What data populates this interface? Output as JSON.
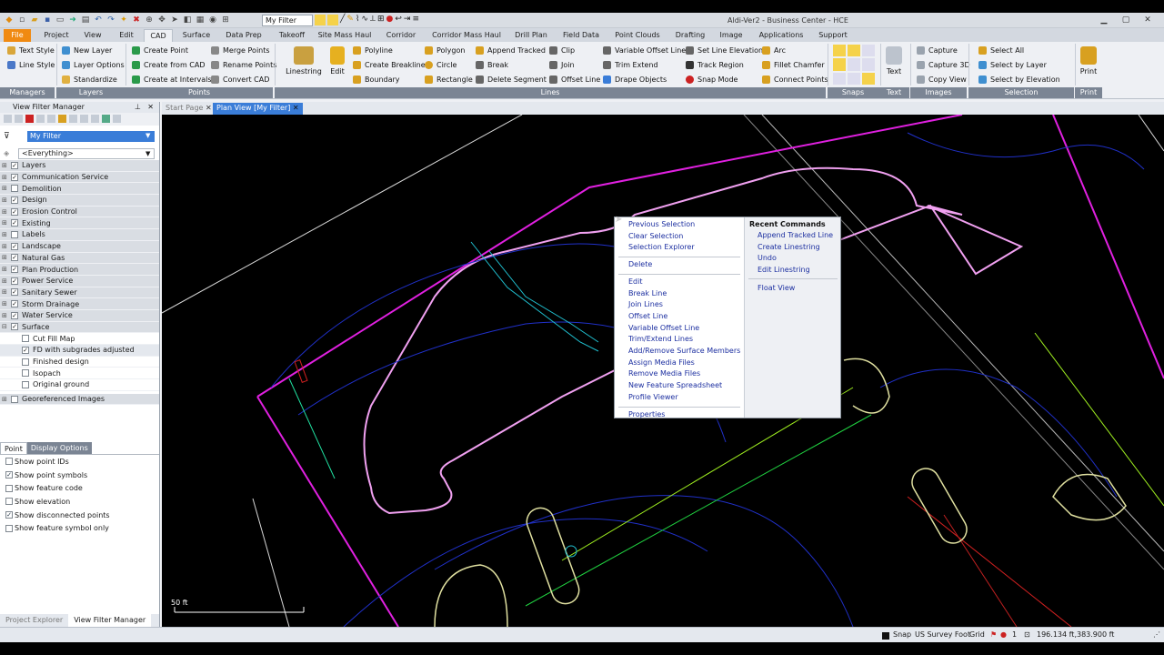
{
  "window": {
    "title": "Aldi-Ver2 - Business Center - HCE",
    "filter_combo": "My Filter"
  },
  "tabs": [
    "File",
    "Project",
    "View",
    "Edit",
    "CAD",
    "Surface",
    "Data Prep",
    "Takeoff",
    "Site Mass Haul",
    "Corridor",
    "Corridor Mass Haul",
    "Drill Plan",
    "Field Data",
    "Point Clouds",
    "Drafting",
    "Image",
    "Applications",
    "Support"
  ],
  "active_tab": "CAD",
  "ribbon": {
    "managers": {
      "text_style": "Text Style",
      "line_style": "Line Style",
      "label": "Managers"
    },
    "layers": {
      "new_layer": "New Layer",
      "layer_options": "Layer Options",
      "standardize": "Standardize",
      "label": "Layers"
    },
    "points": {
      "create_point": "Create Point",
      "create_from_cad": "Create from CAD",
      "create_at_intervals": "Create at Intervals",
      "merge_points": "Merge Points",
      "rename_points": "Rename Points",
      "convert_cad": "Convert CAD",
      "label": "Points"
    },
    "lines": {
      "linestring": "Linestring",
      "edit": "Edit",
      "polyline": "Polyline",
      "create_breakline": "Create Breakline",
      "boundary": "Boundary",
      "polygon": "Polygon",
      "circle": "Circle",
      "rectangle": "Rectangle",
      "append_tracked": "Append Tracked",
      "break": "Break",
      "delete_segment": "Delete Segment",
      "clip": "Clip",
      "join": "Join",
      "offset_line": "Offset Line",
      "variable_offset_line": "Variable Offset Line",
      "trim_extend": "Trim Extend",
      "drape_objects": "Drape Objects",
      "set_line_elevation": "Set Line Elevation",
      "track_region": "Track Region",
      "snap_mode": "Snap Mode",
      "arc": "Arc",
      "fillet_chamfer": "Fillet Chamfer",
      "connect_points": "Connect Points",
      "label": "Lines"
    },
    "snaps": {
      "label": "Snaps"
    },
    "text": {
      "text": "Text",
      "label": "Text"
    },
    "images": {
      "capture": "Capture",
      "capture_3d": "Capture 3D",
      "copy_view": "Copy View",
      "label": "Images"
    },
    "selection": {
      "select_all": "Select All",
      "select_by_layer": "Select by Layer",
      "select_by_elevation": "Select by Elevation",
      "label": "Selection"
    },
    "print": {
      "print": "Print",
      "label": "Print"
    }
  },
  "left_panel": {
    "title": "View Filter Manager",
    "filter": "My Filter",
    "everything": "<Everything>",
    "tree": [
      {
        "label": "Layers",
        "checked": true
      },
      {
        "label": "Communication Service",
        "checked": true
      },
      {
        "label": "Demolition",
        "checked": false
      },
      {
        "label": "Design",
        "checked": true
      },
      {
        "label": "Erosion Control",
        "checked": true
      },
      {
        "label": "Existing",
        "checked": true
      },
      {
        "label": "Labels",
        "checked": false
      },
      {
        "label": "Landscape",
        "checked": true
      },
      {
        "label": "Natural Gas",
        "checked": true
      },
      {
        "label": "Plan Production",
        "checked": true
      },
      {
        "label": "Power Service",
        "checked": true
      },
      {
        "label": "Sanitary Sewer",
        "checked": true
      },
      {
        "label": "Storm Drainage",
        "checked": true
      },
      {
        "label": "Water Service",
        "checked": true
      },
      {
        "label": "Surface",
        "checked": true
      }
    ],
    "surface_children": [
      {
        "label": "Cut Fill Map",
        "checked": false
      },
      {
        "label": "FD with subgrades adjusted",
        "checked": true
      },
      {
        "label": "Finished design",
        "checked": false
      },
      {
        "label": "Isopach",
        "checked": false
      },
      {
        "label": "Original ground",
        "checked": false
      }
    ],
    "georef": "Georeferenced Images",
    "display_tabs": [
      "Point",
      "Display Options"
    ],
    "display_options": [
      {
        "label": "Show point IDs",
        "checked": false
      },
      {
        "label": "Show point symbols",
        "checked": true
      },
      {
        "label": "Show feature code",
        "checked": false
      },
      {
        "label": "Show elevation",
        "checked": false
      },
      {
        "label": "Show disconnected points",
        "checked": true
      },
      {
        "label": "Show feature symbol only",
        "checked": false
      }
    ],
    "bottom_tabs": [
      "Project Explorer",
      "View Filter Manager"
    ]
  },
  "doc_tabs": [
    "Start Page",
    "Plan View [My Filter]"
  ],
  "canvas": {
    "scale_label": "50 ft"
  },
  "context_menu": {
    "left_items": [
      {
        "group": 0,
        "items": [
          "Previous Selection",
          "Clear Selection",
          "Selection Explorer"
        ]
      },
      {
        "group": 1,
        "items": [
          "Delete"
        ]
      },
      {
        "group": 2,
        "items": [
          "Edit",
          "Break Line",
          "Join Lines",
          "Offset Line",
          "Variable Offset Line",
          "Trim/Extend Lines",
          "Add/Remove Surface Members",
          "Assign Media Files",
          "Remove Media Files",
          "New Feature Spreadsheet",
          "Profile Viewer"
        ]
      },
      {
        "group": 3,
        "items": [
          "Properties"
        ]
      }
    ],
    "recent_header": "Recent Commands",
    "recent_items": [
      "Append Tracked Line",
      "Create Linestring",
      "Undo",
      "Edit Linestring"
    ],
    "float_view": "Float View"
  },
  "status": {
    "snap": "Snap",
    "units": "US Survey Foot",
    "grid": "Grid",
    "count": "1",
    "coords": "196.134 ft,383.900 ft"
  }
}
